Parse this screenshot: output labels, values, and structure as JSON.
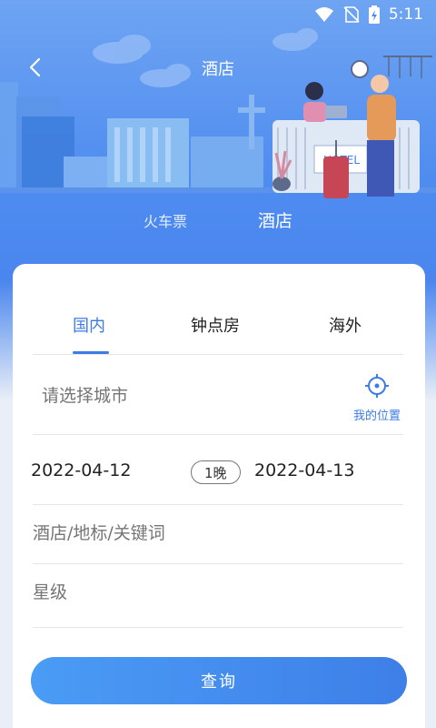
{
  "status_bar": {
    "time": "5:11"
  },
  "nav": {
    "title": "酒店"
  },
  "top_tabs": [
    {
      "label": "火车票"
    },
    {
      "label": "酒店"
    }
  ],
  "sub_tabs": [
    {
      "label": "国内"
    },
    {
      "label": "钟点房"
    },
    {
      "label": "海外"
    }
  ],
  "search": {
    "city_placeholder": "请选择城市",
    "locate_label": "我的位置",
    "checkin": "2022-04-12",
    "nights": "1晚",
    "checkout": "2022-04-13",
    "keyword_placeholder": "酒店/地标/关键词",
    "star_placeholder": "星级",
    "button_label": "查询"
  },
  "illustration": {
    "hotel_sign": "HOTEL"
  },
  "colors": {
    "accent": "#3d7be6",
    "header": "#4f8cf0"
  }
}
